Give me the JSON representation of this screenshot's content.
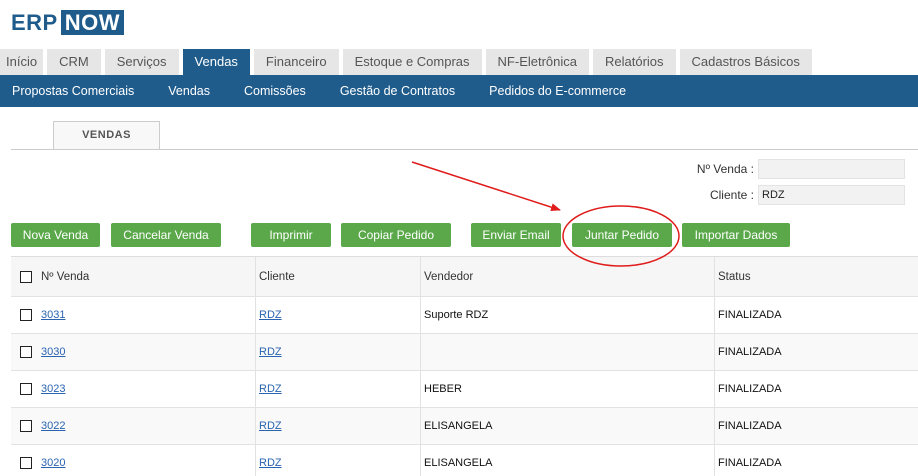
{
  "brand": {
    "part1": "ERP",
    "part2": "NOW"
  },
  "tabs": [
    {
      "label": "Início",
      "active": false
    },
    {
      "label": "CRM",
      "active": false
    },
    {
      "label": "Serviços",
      "active": false
    },
    {
      "label": "Vendas",
      "active": true
    },
    {
      "label": "Financeiro",
      "active": false
    },
    {
      "label": "Estoque e Compras",
      "active": false
    },
    {
      "label": "NF-Eletrônica",
      "active": false
    },
    {
      "label": "Relatórios",
      "active": false
    },
    {
      "label": "Cadastros Básicos",
      "active": false
    }
  ],
  "subnav": [
    "Propostas Comerciais",
    "Vendas",
    "Comissões",
    "Gestão de Contratos",
    "Pedidos do E-commerce"
  ],
  "section_tab": "VENDAS",
  "filters": {
    "num_venda_label": "Nº Venda :",
    "num_venda_value": "",
    "cliente_label": "Cliente :",
    "cliente_value": "RDZ"
  },
  "actions": {
    "nova_venda": "Nova Venda",
    "cancelar_venda": "Cancelar Venda",
    "imprimir": "Imprimir",
    "copiar_pedido": "Copiar Pedido",
    "enviar_email": "Enviar Email",
    "juntar_pedido": "Juntar Pedido",
    "importar_dados": "Importar Dados"
  },
  "table": {
    "headers": {
      "num_venda": "Nº Venda",
      "cliente": "Cliente",
      "vendedor": "Vendedor",
      "status": "Status"
    },
    "rows": [
      {
        "num_venda": "3031",
        "cliente": "RDZ",
        "vendedor": "Suporte RDZ",
        "status": "FINALIZADA"
      },
      {
        "num_venda": "3030",
        "cliente": "RDZ",
        "vendedor": "",
        "status": "FINALIZADA"
      },
      {
        "num_venda": "3023",
        "cliente": "RDZ",
        "vendedor": "HEBER",
        "status": "FINALIZADA"
      },
      {
        "num_venda": "3022",
        "cliente": "RDZ",
        "vendedor": "ELISANGELA",
        "status": "FINALIZADA"
      },
      {
        "num_venda": "3020",
        "cliente": "RDZ",
        "vendedor": "ELISANGELA",
        "status": "FINALIZADA"
      }
    ]
  },
  "colors": {
    "brand_blue": "#1f5c8c",
    "button_green": "#5aa84a",
    "annotation_red": "#e01b1b",
    "link_blue": "#2a64b0"
  }
}
